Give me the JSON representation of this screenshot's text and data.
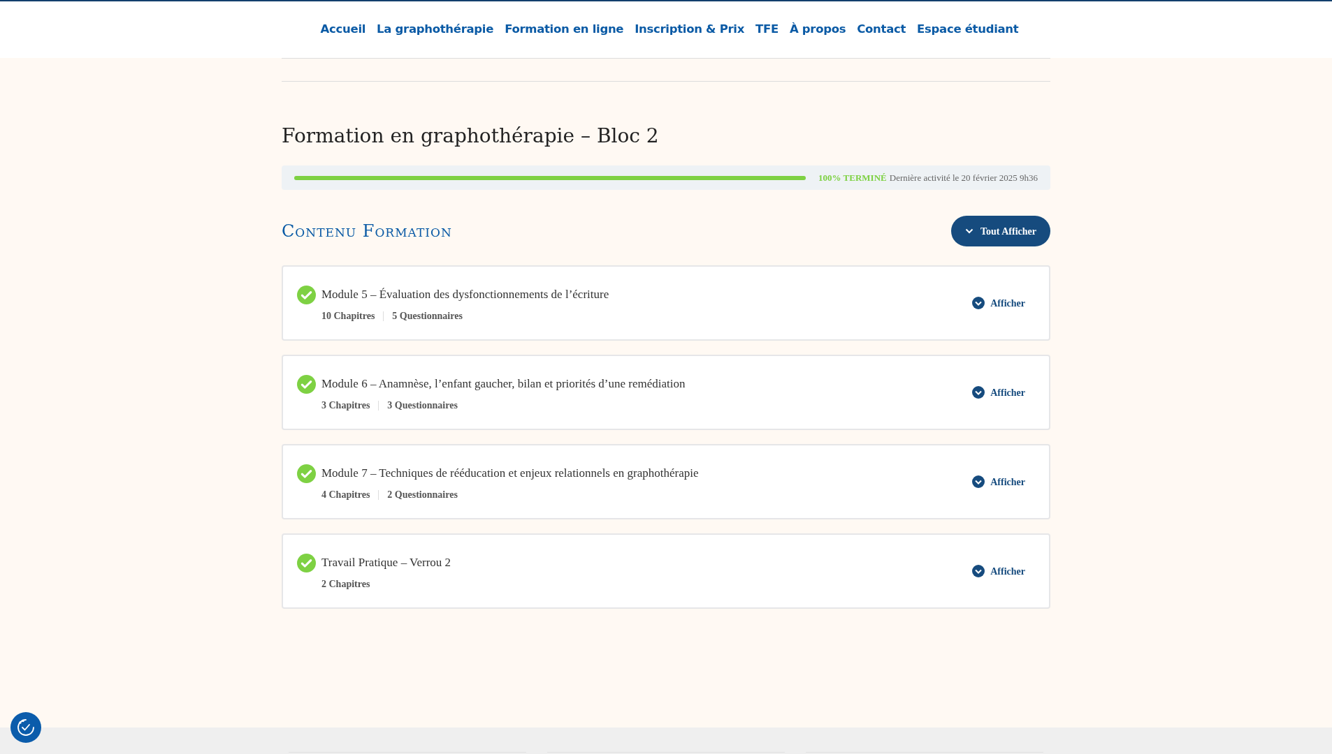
{
  "nav": {
    "items": [
      "Accueil",
      "La graphothérapie",
      "Formation en ligne",
      "Inscription & Prix",
      "TFE",
      "À propos",
      "Contact",
      "Espace étudiant"
    ]
  },
  "course": {
    "title": "Formation en graphothérapie – Bloc 2",
    "progress": {
      "level": 1,
      "status": "100% TERMINÉ",
      "last_activity": "Dernière activité le 20 février 2025 9h36"
    }
  },
  "content": {
    "heading": "Contenu Formation",
    "expand_all": "Tout Afficher",
    "modules": [
      {
        "title": "Module 5 – Évaluation des dysfonctionnements de l’écriture",
        "completed": true,
        "meta": [
          "10 Chapitres",
          "5 Questionnaires"
        ],
        "action": "Afficher"
      },
      {
        "title": "Module 6 – Anamnèse, l’enfant gaucher, bilan et priorités d’une remédiation",
        "completed": true,
        "meta": [
          "3 Chapitres",
          "3 Questionnaires"
        ],
        "action": "Afficher"
      },
      {
        "title": "Module 7 – Techniques de rééducation et enjeux relationnels en graphothérapie",
        "completed": true,
        "meta": [
          "4 Chapitres",
          "2 Questionnaires"
        ],
        "action": "Afficher"
      },
      {
        "title": "Travail Pratique – Verrou 2",
        "completed": true,
        "meta": [
          "2 Chapitres"
        ],
        "action": "Afficher"
      }
    ]
  }
}
